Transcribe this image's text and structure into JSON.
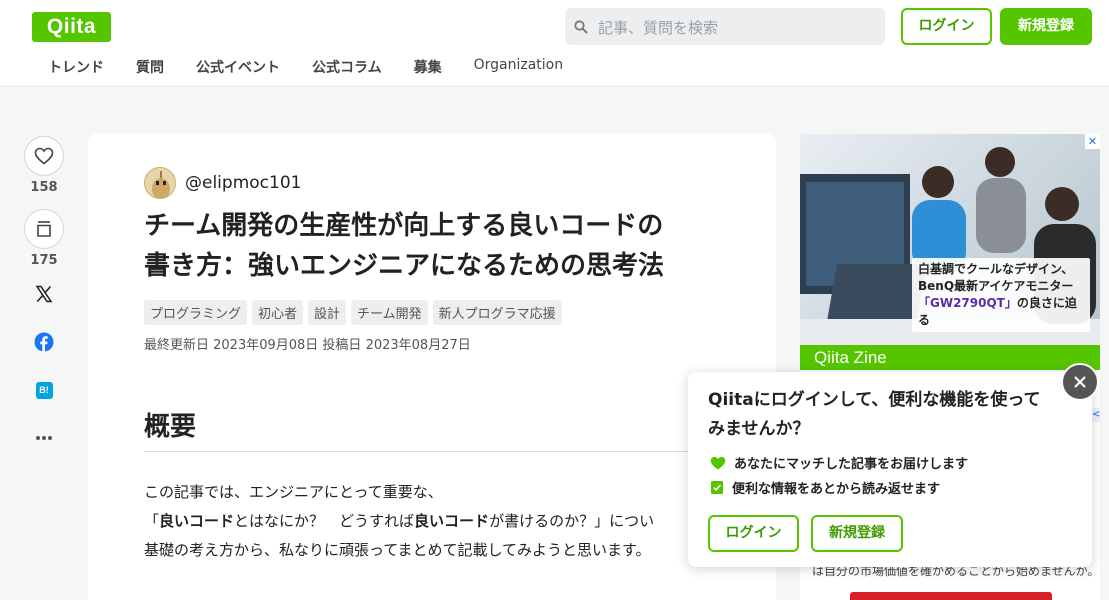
{
  "header": {
    "logo_text": "Qiita",
    "search_placeholder": "記事、質問を検索",
    "login_label": "ログイン",
    "signup_label": "新規登録",
    "nav": [
      "トレンド",
      "質問",
      "公式イベント",
      "公式コラム",
      "募集",
      "Organization"
    ]
  },
  "rail": {
    "like_count": "158",
    "stock_count": "175",
    "icons": [
      "heart-icon",
      "stock-icon",
      "x-icon",
      "facebook-icon",
      "hatena-bookmark-icon",
      "more-icon"
    ],
    "hatena_label": "B!"
  },
  "article": {
    "username": "@elipmoc101",
    "title_line1": "チーム開発の生産性が向上する良いコードの",
    "title_line2": "書き方：強いエンジニアになるための思考法",
    "tags": [
      "プログラミング",
      "初心者",
      "設計",
      "チーム開発",
      "新人プログラマ応援"
    ],
    "dates": "最終更新日 2023年09月08日  投稿日 2023年08月27日",
    "section_heading": "概要",
    "body_line1": "この記事では、エンジニアにとって重要な、",
    "body_line2_a": "「",
    "body_line2_b": "良いコード",
    "body_line2_c": "とはなにか？　どうすれば",
    "body_line2_d": "良いコード",
    "body_line2_e": "が書けるのか？」につい",
    "body_line3": "基礎の考え方から、私なりに頑張ってまとめて記載してみようと思います。"
  },
  "ad": {
    "caption_line1": "白基調でクールなデザイン、",
    "caption_line2": "BenQ最新アイケアモニター",
    "caption_line3a": "「GW2790QT」",
    "caption_line3b": "の良さに迫る",
    "bar_label": "Qiita Zine",
    "below_text": "は自分の市場価値を確かめることから始めませんか。"
  },
  "popup": {
    "title": "Qiitaにログインして、便利な機能を使ってみませんか？",
    "item1": "あなたにマッチした記事をお届けします",
    "item2": "便利な情報をあとから読み返せます",
    "login_label": "ログイン",
    "signup_label": "新規登録"
  },
  "colors": {
    "brand_green": "#55c500",
    "text": "#222222",
    "page_bg": "#f5f6f6"
  }
}
